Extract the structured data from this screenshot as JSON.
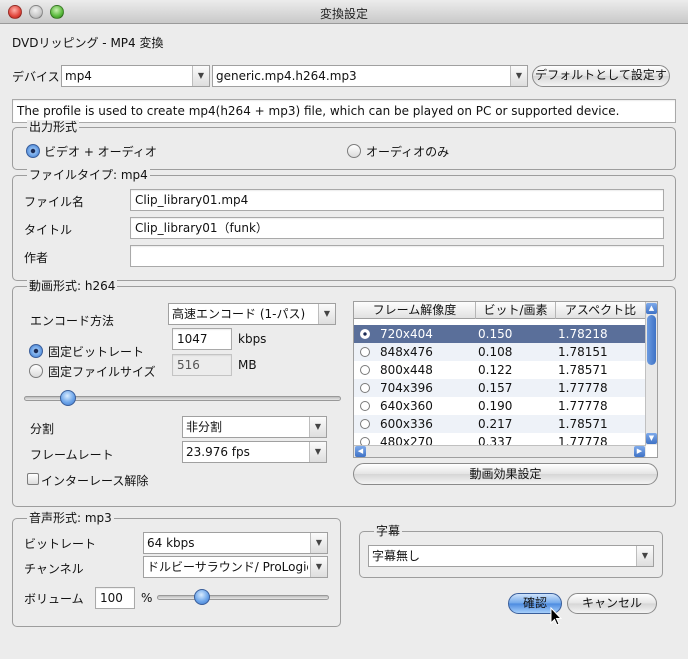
{
  "window": {
    "title": "変換設定",
    "subtitle": "DVDリッピング - MP4 変換"
  },
  "device": {
    "label": "デバイス",
    "device_value": "mp4",
    "profile_value": "generic.mp4.h264.mp3",
    "set_default_button": "デフォルトとして設定す",
    "description": "The profile is used to create mp4(h264 + mp3) file, which can be played on PC or supported device."
  },
  "output_format": {
    "legend": "出力形式",
    "video_audio": "ビデオ + オーディオ",
    "audio_only": "オーディオのみ"
  },
  "file_type": {
    "legend": "ファイルタイプ: mp4",
    "filename_label": "ファイル名",
    "filename_value": "Clip_library01.mp4",
    "title_label": "タイトル",
    "title_value": "Clip_library01（funk）",
    "author_label": "作者",
    "author_value": ""
  },
  "video": {
    "legend": "動画形式: h264",
    "encode_label": "エンコード方法",
    "encode_value": "高速エンコード (1-パス)",
    "fixed_bitrate_label": "固定ビットレート",
    "bitrate_value": "1047",
    "bitrate_unit": "kbps",
    "fixed_size_label": "固定ファイルサイズ",
    "size_value": "516",
    "size_unit": "MB",
    "bitrate_slider_fraction": 0.12,
    "split_label": "分割",
    "split_value": "非分割",
    "framerate_label": "フレームレート",
    "framerate_value": "23.976 fps",
    "deinterlace_label": "インターレース解除",
    "effects_button": "動画効果設定",
    "table": {
      "headers": [
        "フレーム解像度",
        "ビット/画素",
        "アスペクト比"
      ],
      "rows": [
        {
          "res": "720x404",
          "bpp": "0.150",
          "aspect": "1.78218",
          "selected": true
        },
        {
          "res": "848x476",
          "bpp": "0.108",
          "aspect": "1.78151",
          "selected": false
        },
        {
          "res": "800x448",
          "bpp": "0.122",
          "aspect": "1.78571",
          "selected": false
        },
        {
          "res": "704x396",
          "bpp": "0.157",
          "aspect": "1.77778",
          "selected": false
        },
        {
          "res": "640x360",
          "bpp": "0.190",
          "aspect": "1.77778",
          "selected": false
        },
        {
          "res": "600x336",
          "bpp": "0.217",
          "aspect": "1.78571",
          "selected": false
        },
        {
          "res": "480x270",
          "bpp": "0.337",
          "aspect": "1.77778",
          "selected": false
        }
      ]
    }
  },
  "audio": {
    "legend": "音声形式: mp3",
    "bitrate_label": "ビットレート",
    "bitrate_value": "64 kbps",
    "channel_label": "チャンネル",
    "channel_value": "ドルビーサラウンド/ ProLogic",
    "volume_label": "ボリューム",
    "volume_value": "100",
    "volume_unit": "%",
    "volume_slider_fraction": 0.24
  },
  "subtitle": {
    "legend": "字幕",
    "value": "字幕無し"
  },
  "buttons": {
    "ok": "確認",
    "cancel": "キャンセル"
  },
  "colors": {
    "accent": "#4b8ae0",
    "selection": "#5a6f9a",
    "background": "#ececec"
  }
}
